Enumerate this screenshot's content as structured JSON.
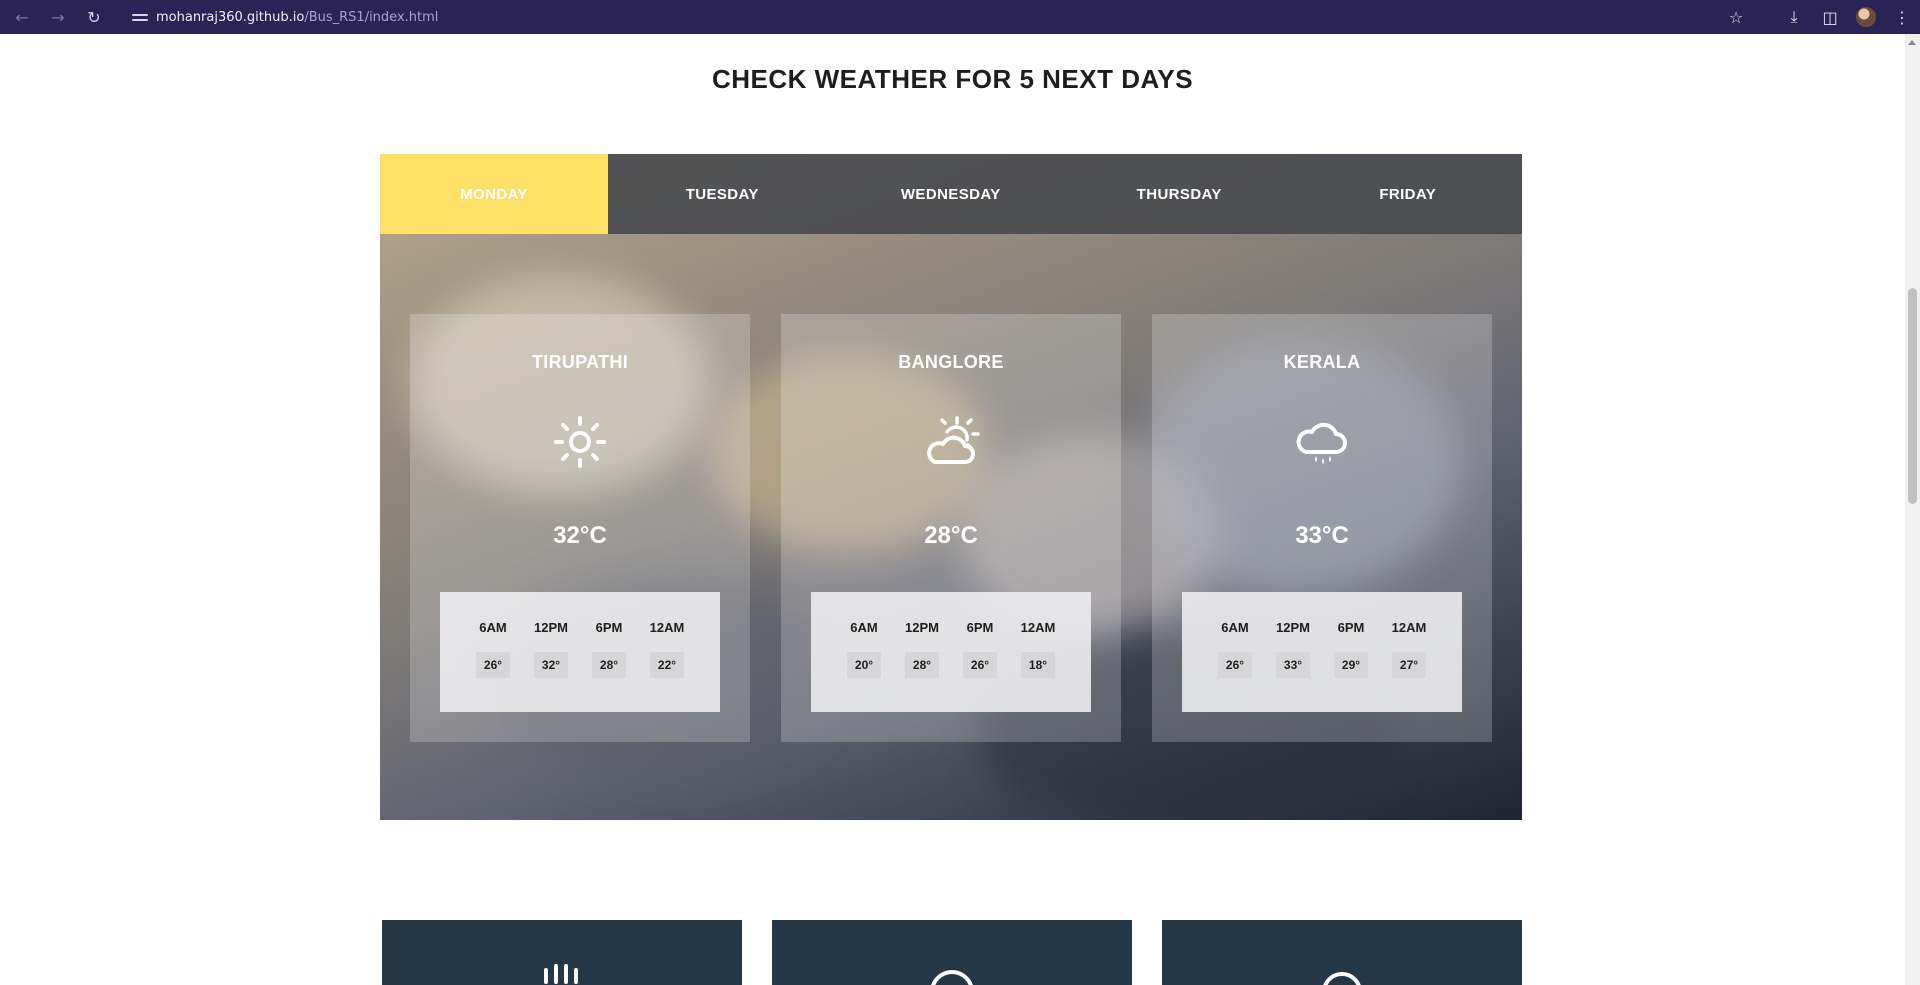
{
  "browser": {
    "url_host": "mohanraj360.github.io",
    "url_path": "/Bus_RS1/index.html",
    "icons": [
      "back-arrow-icon",
      "forward-arrow-icon",
      "reload-icon",
      "site-info-icon",
      "star-icon",
      "download-icon",
      "sidebar-icon",
      "profile-avatar",
      "menu-icon"
    ]
  },
  "section": {
    "title": "CHECK WEATHER FOR 5 NEXT DAYS"
  },
  "tabs": [
    {
      "label": "MONDAY",
      "active": true
    },
    {
      "label": "TUESDAY",
      "active": false
    },
    {
      "label": "WEDNESDAY",
      "active": false
    },
    {
      "label": "THURSDAY",
      "active": false
    },
    {
      "label": "FRIDAY",
      "active": false
    }
  ],
  "cards": [
    {
      "city": "TIRUPATHI",
      "icon": "sun-icon",
      "temp": "32°C",
      "hours": [
        {
          "label": "6AM",
          "value": "26°"
        },
        {
          "label": "12PM",
          "value": "32°"
        },
        {
          "label": "6PM",
          "value": "28°"
        },
        {
          "label": "12AM",
          "value": "22°"
        }
      ]
    },
    {
      "city": "BANGLORE",
      "icon": "partly-cloudy-icon",
      "temp": "28°C",
      "hours": [
        {
          "label": "6AM",
          "value": "20°"
        },
        {
          "label": "12PM",
          "value": "28°"
        },
        {
          "label": "6PM",
          "value": "26°"
        },
        {
          "label": "12AM",
          "value": "18°"
        }
      ]
    },
    {
      "city": "KERALA",
      "icon": "rain-cloud-icon",
      "temp": "33°C",
      "hours": [
        {
          "label": "6AM",
          "value": "26°"
        },
        {
          "label": "12PM",
          "value": "33°"
        },
        {
          "label": "6PM",
          "value": "29°"
        },
        {
          "label": "12AM",
          "value": "27°"
        }
      ]
    }
  ],
  "colors": {
    "active_tab": "#ffe066",
    "tab_bar": "#46484c",
    "bottom_card": "#233746",
    "browser_chrome": "#2b2356"
  }
}
